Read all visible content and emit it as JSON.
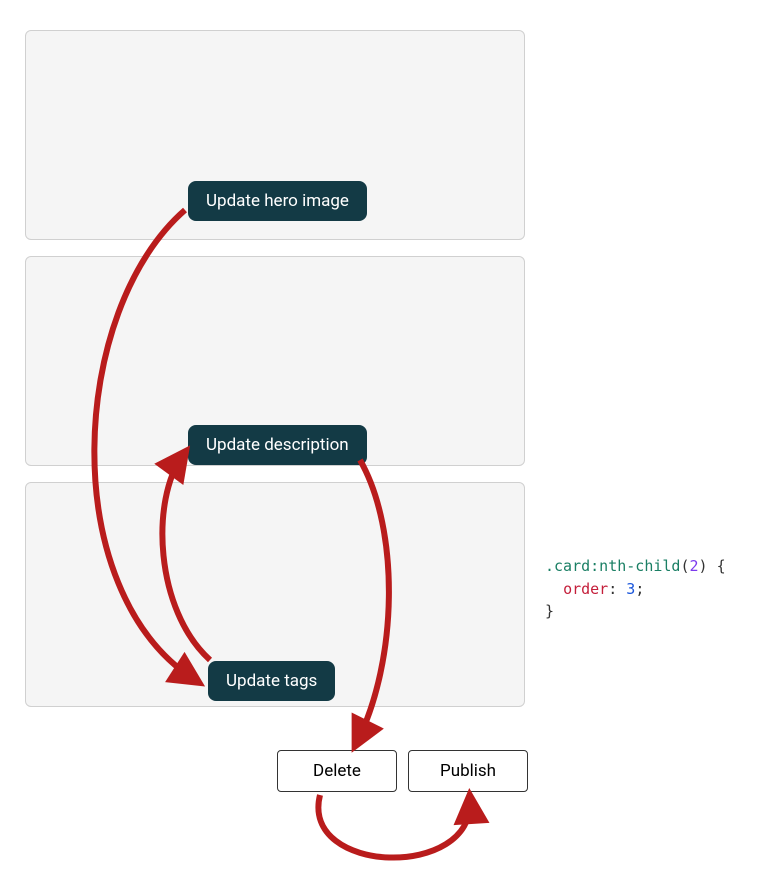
{
  "cards": {
    "card1_label": "Update hero image",
    "card2_label": "Update description",
    "card3_label": "Update tags"
  },
  "actions": {
    "delete_label": "Delete",
    "publish_label": "Publish"
  },
  "code": {
    "selector_class": ".card",
    "selector_pseudo": ":nth-child",
    "selector_arg": "2",
    "rule_property": "order",
    "rule_value": "3"
  },
  "colors": {
    "arrow": "#B91C1C",
    "pill_bg": "#133a45",
    "card_bg": "#f5f5f5",
    "card_border": "#d0d0d0"
  }
}
